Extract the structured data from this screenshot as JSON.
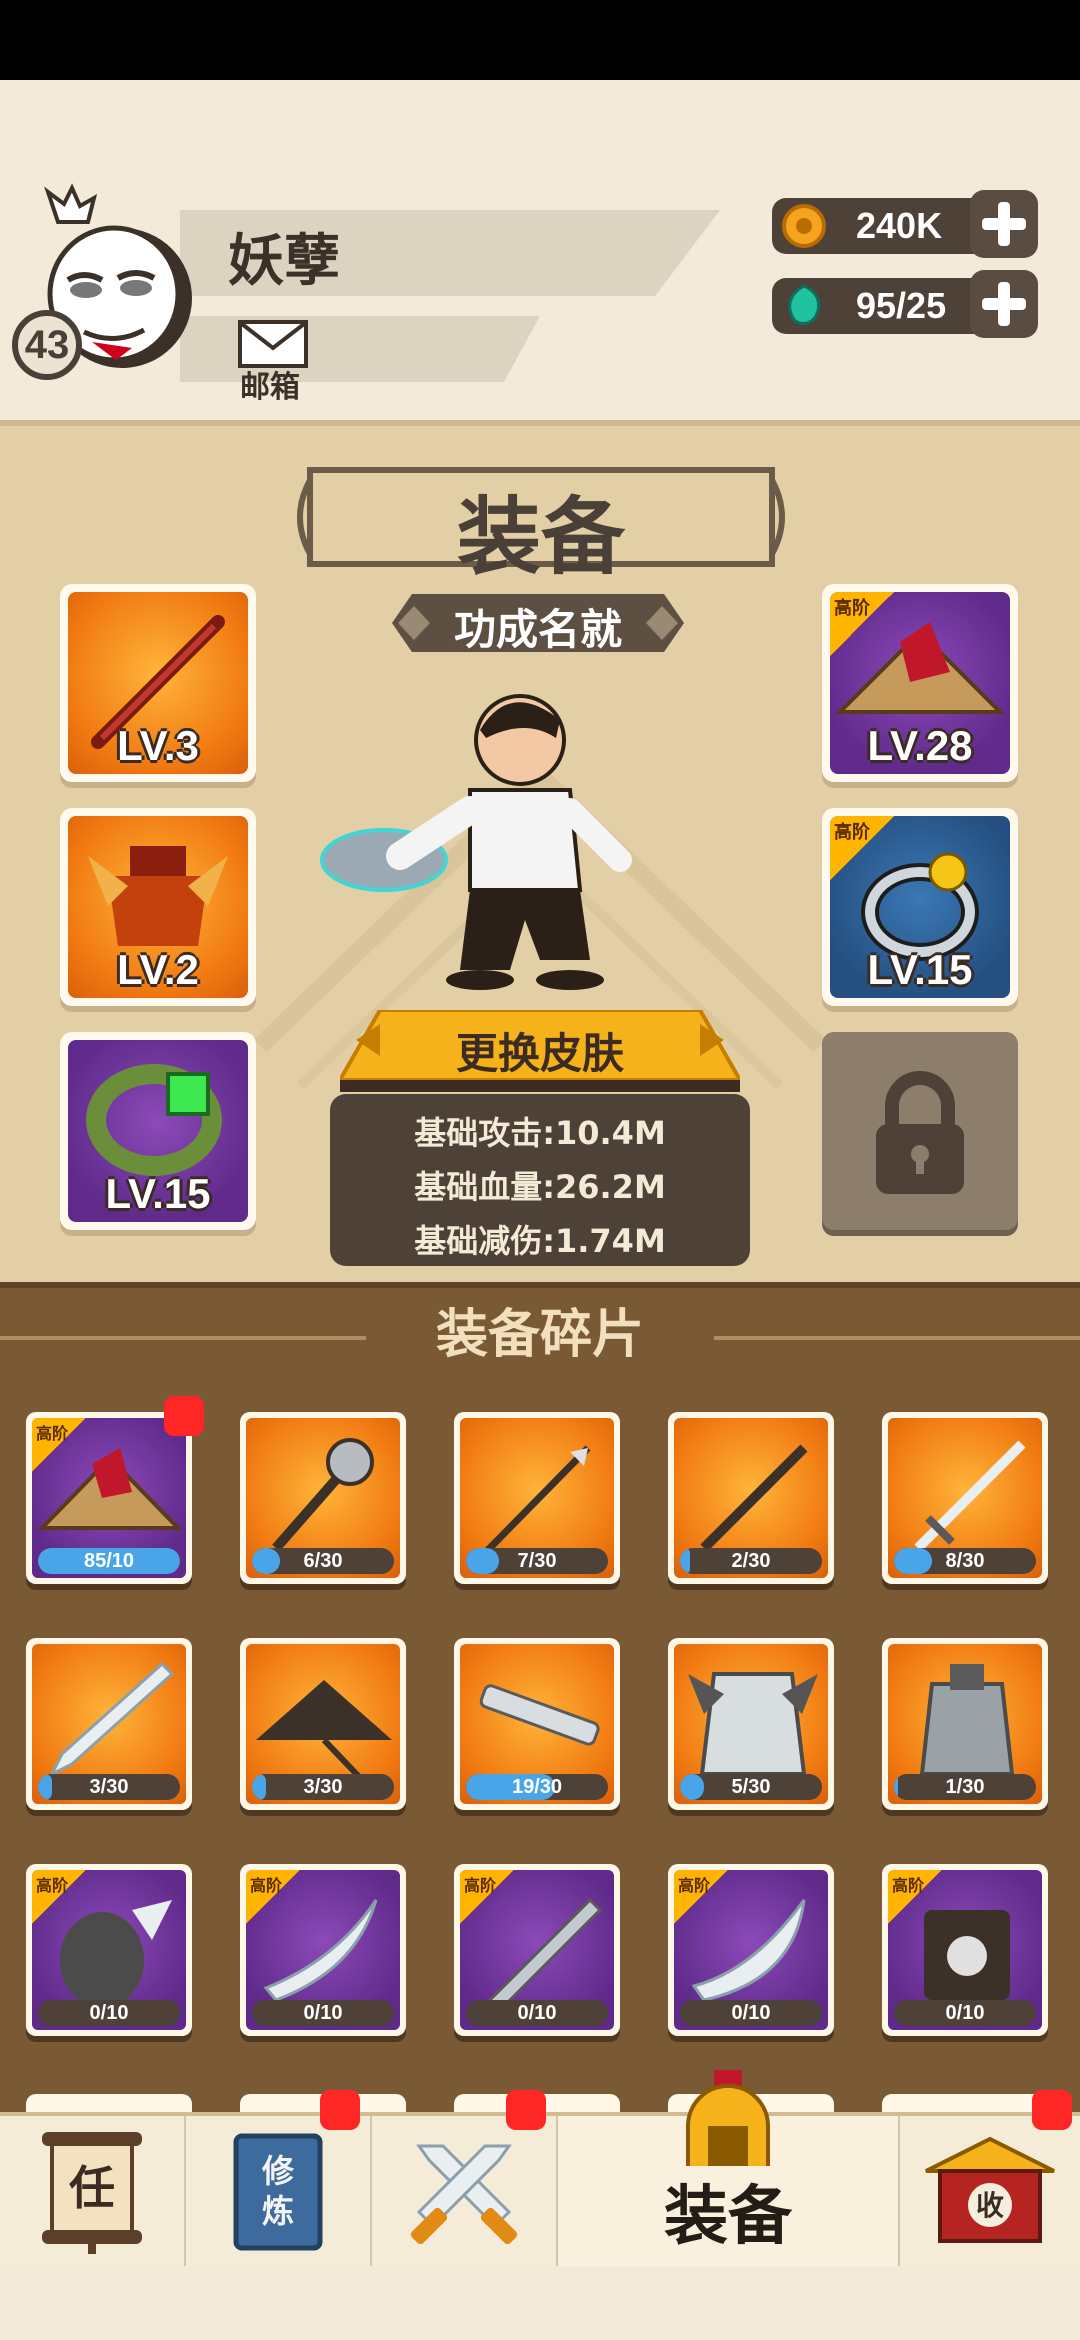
{
  "player": {
    "name": "妖孽",
    "level": "43"
  },
  "mail": {
    "label": "邮箱"
  },
  "resources": {
    "coins": "240K",
    "gems": "95/25"
  },
  "equipment": {
    "title": "装备",
    "achievement": "功成名就",
    "slots": [
      {
        "item": "staff",
        "level": "LV.3",
        "rarity": "orange"
      },
      {
        "item": "armor",
        "level": "LV.2",
        "rarity": "orange"
      },
      {
        "item": "bracelet",
        "level": "LV.15",
        "rarity": "purple"
      },
      {
        "item": "hat",
        "level": "LV.28",
        "rarity": "purple",
        "grade": "高阶"
      },
      {
        "item": "ring",
        "level": "LV.15",
        "rarity": "blue",
        "grade": "高阶"
      }
    ],
    "locked_slot": "lock-icon",
    "skin_button": "更换皮肤",
    "stats": {
      "attack": "基础攻击:10.4M",
      "hp": "基础血量:26.2M",
      "damage_reduction": "基础减伤:1.74M"
    }
  },
  "fragments": {
    "title": "装备碎片",
    "items": [
      {
        "name": "hat",
        "text": "85/10",
        "progress": 1.0,
        "rarity": "purple",
        "grade": "高阶",
        "badge": true
      },
      {
        "name": "mace",
        "text": "6/30",
        "progress": 0.2,
        "rarity": "orange"
      },
      {
        "name": "spear",
        "text": "7/30",
        "progress": 0.23,
        "rarity": "orange"
      },
      {
        "name": "staff",
        "text": "2/30",
        "progress": 0.07,
        "rarity": "orange"
      },
      {
        "name": "sword",
        "text": "8/30",
        "progress": 0.27,
        "rarity": "orange"
      },
      {
        "name": "blade",
        "text": "3/30",
        "progress": 0.1,
        "rarity": "orange"
      },
      {
        "name": "straw-hat",
        "text": "3/30",
        "progress": 0.1,
        "rarity": "orange"
      },
      {
        "name": "gun",
        "text": "19/30",
        "progress": 0.63,
        "rarity": "orange"
      },
      {
        "name": "robe",
        "text": "5/30",
        "progress": 0.17,
        "rarity": "orange"
      },
      {
        "name": "armor",
        "text": "1/30",
        "progress": 0.03,
        "rarity": "orange"
      },
      {
        "name": "gauntlet",
        "text": "0/10",
        "progress": 0,
        "rarity": "purple",
        "grade": "高阶"
      },
      {
        "name": "saber",
        "text": "0/10",
        "progress": 0,
        "rarity": "purple",
        "grade": "高阶"
      },
      {
        "name": "broadsword",
        "text": "0/10",
        "progress": 0,
        "rarity": "purple",
        "grade": "高阶"
      },
      {
        "name": "scimitar",
        "text": "0/10",
        "progress": 0,
        "rarity": "purple",
        "grade": "高阶"
      },
      {
        "name": "chest",
        "text": "0/10",
        "progress": 0,
        "rarity": "purple",
        "grade": "高阶"
      }
    ]
  },
  "nav": {
    "tasks": "任",
    "training": "修炼",
    "battle": "swords-icon",
    "equipment": "装备",
    "shop": "收"
  },
  "colors": {
    "orange_tile": "#f07810",
    "purple_tile": "#5f2a8a",
    "blue_tile": "#244f80",
    "progress_fill": "#4aa5e8",
    "badge_red": "#ff2626"
  }
}
